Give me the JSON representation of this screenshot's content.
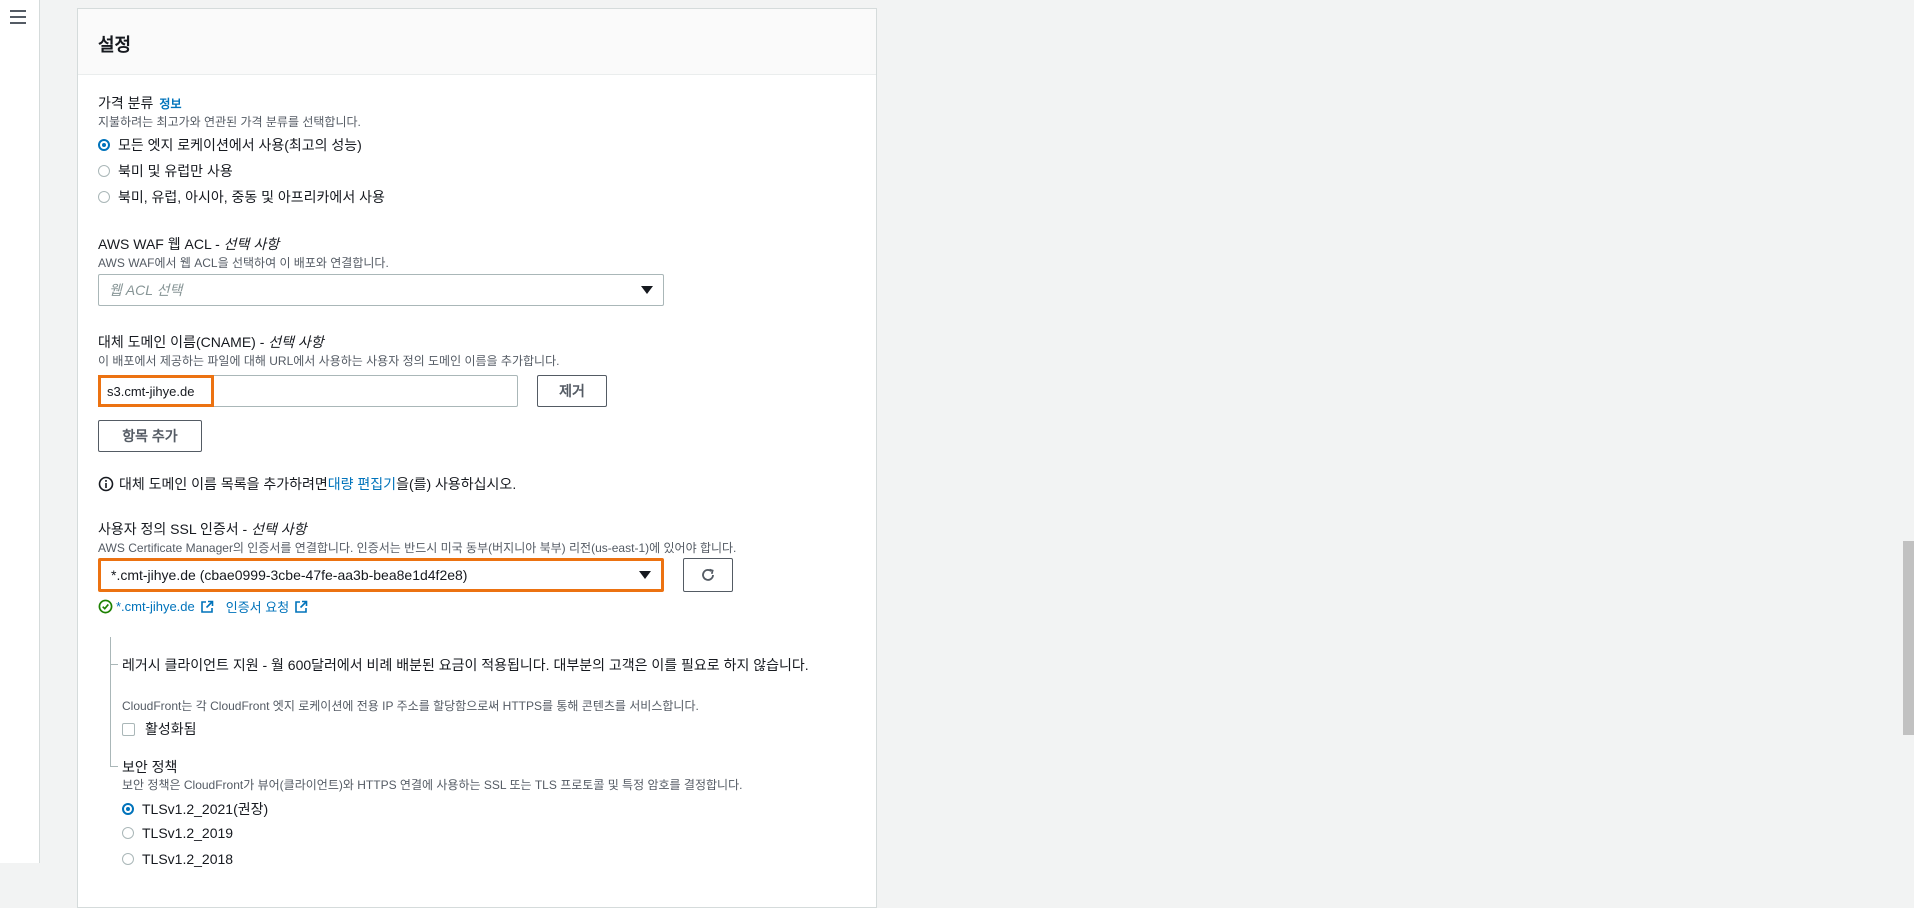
{
  "panel": {
    "title": "설정"
  },
  "price_class": {
    "label": "가격 분류",
    "info": "정보",
    "description": "지불하려는 최고가와 연관된 가격 분류를 선택합니다.",
    "options": [
      {
        "label": "모든 엣지 로케이션에서 사용(최고의 성능)",
        "selected": true
      },
      {
        "label": "북미 및 유럽만 사용",
        "selected": false
      },
      {
        "label": "북미, 유럽, 아시아, 중동 및 아프리카에서 사용",
        "selected": false
      }
    ]
  },
  "waf": {
    "label": "AWS WAF 웹 ACL - ",
    "label_optional": "선택 사항",
    "description": "AWS WAF에서 웹 ACL을 선택하여 이 배포와 연결합니다.",
    "placeholder": "웹 ACL 선택"
  },
  "cname": {
    "label": "대체 도메인 이름(CNAME) - ",
    "label_optional": "선택 사항",
    "description": "이 배포에서 제공하는 파일에 대해 URL에서 사용하는 사용자 정의 도메인 이름을 추가합니다.",
    "value": "s3.cmt-jihye.de",
    "remove_label": "제거",
    "add_label": "항목 추가",
    "info_prefix": "대체 도메인 이름 목록을 추가하려면 ",
    "info_link": "대량 편집기",
    "info_suffix": "을(를) 사용하십시오."
  },
  "ssl": {
    "label": "사용자 정의 SSL 인증서 - ",
    "label_optional": "선택 사항",
    "description": "AWS Certificate Manager의 인증서를 연결합니다. 인증서는 반드시 미국 동부(버지니아 북부) 리전(us-east-1)에 있어야 합니다.",
    "value": "*.cmt-jihye.de (cbae0999-3cbe-47fe-aa3b-bea8e1d4f2e8)",
    "cert_link": "*.cmt-jihye.de",
    "request_link": "인증서 요청"
  },
  "legacy": {
    "label": "레거시 클라이언트 지원 - 월 600달러에서 비례 배분된 요금이 적용됩니다. 대부분의 고객은 이를 필요로 하지 않습니다.",
    "description": "CloudFront는 각 CloudFront 엣지 로케이션에 전용 IP 주소를 할당함으로써 HTTPS를 통해 콘텐츠를 서비스합니다.",
    "checkbox_label": "활성화됨"
  },
  "security_policy": {
    "label": "보안 정책",
    "description": "보안 정책은 CloudFront가 뷰어(클라이언트)와 HTTPS 연결에 사용하는 SSL 또는 TLS 프로토콜 및 특정 암호를 결정합니다.",
    "options": [
      {
        "label": "TLSv1.2_2021(권장)",
        "selected": true
      },
      {
        "label": "TLSv1.2_2019",
        "selected": false
      },
      {
        "label": "TLSv1.2_2018",
        "selected": false
      }
    ]
  },
  "colors": {
    "accent": "#0073bb",
    "highlight": "#ec7211",
    "success": "#1d8102"
  }
}
